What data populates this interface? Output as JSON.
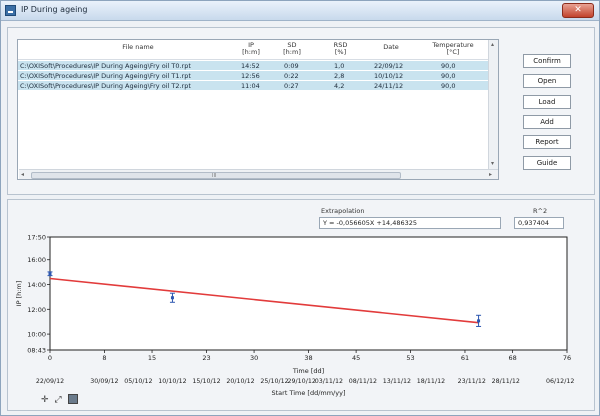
{
  "window": {
    "title": "IP During ageing",
    "close_glyph": "✕"
  },
  "table": {
    "columns": [
      {
        "key": "file",
        "label": "File name"
      },
      {
        "key": "ip",
        "label": "IP\n[h:m]"
      },
      {
        "key": "sd",
        "label": "SD\n[h:m]"
      },
      {
        "key": "rsd",
        "label": "RSD\n[%]"
      },
      {
        "key": "date",
        "label": "Date"
      },
      {
        "key": "temp",
        "label": "Temperature\n[°C]"
      }
    ],
    "rows": [
      {
        "file": "C:\\OXISoft\\Procedures\\IP During Ageing\\Fry oil T0.rpt",
        "ip": "14:52",
        "sd": "0:09",
        "rsd": "1,0",
        "date": "22/09/12",
        "temp": "90,0"
      },
      {
        "file": "C:\\OXISoft\\Procedures\\IP During Ageing\\Fry oil T1.rpt",
        "ip": "12:56",
        "sd": "0:22",
        "rsd": "2,8",
        "date": "10/10/12",
        "temp": "90,0"
      },
      {
        "file": "C:\\OXISoft\\Procedures\\IP During Ageing\\Fry oil T2.rpt",
        "ip": "11:04",
        "sd": "0:27",
        "rsd": "4,2",
        "date": "24/11/12",
        "temp": "90,0"
      }
    ],
    "scroll_left": "◂",
    "scroll_right": "▸",
    "scroll_up": "▴",
    "scroll_down": "▾",
    "scroll_grip": "III"
  },
  "buttons": {
    "confirm": "Confirm",
    "open": "Open",
    "load": "Load",
    "add": "Add",
    "report": "Report",
    "guide": "Guide"
  },
  "extrapolation": {
    "label": "Extrapolation",
    "equation": "Y = -0,056605X +14,486325",
    "r2_label": "R^2",
    "r2_value": "0,937404"
  },
  "colors": {
    "fit_line": "#e23b3b",
    "points": "#2b56b0",
    "row_highlight": "#c9e3ef"
  },
  "chart_data": {
    "type": "scatter",
    "ylabel": "IP [h:m]",
    "xlabel": "Time [dd]",
    "x2label": "Start Time [dd/mm/yy]",
    "xlim": [
      0,
      76
    ],
    "ylim": [
      8.717,
      17.833
    ],
    "x_ticks": [
      0,
      8,
      15,
      23,
      30,
      38,
      45,
      53,
      61,
      68,
      76
    ],
    "y_ticks": [
      {
        "value": 8.717,
        "label": "08:43"
      },
      {
        "value": 10,
        "label": "10:00"
      },
      {
        "value": 12,
        "label": "12:00"
      },
      {
        "value": 14,
        "label": "14:00"
      },
      {
        "value": 16,
        "label": "16:00"
      },
      {
        "value": 17.833,
        "label": "17:50"
      }
    ],
    "date_ticks": [
      {
        "x": 0,
        "label": "22/09/12"
      },
      {
        "x": 8,
        "label": "30/09/12"
      },
      {
        "x": 13,
        "label": "05/10/12"
      },
      {
        "x": 18,
        "label": "10/10/12"
      },
      {
        "x": 23,
        "label": "15/10/12"
      },
      {
        "x": 28,
        "label": "20/10/12"
      },
      {
        "x": 33,
        "label": "25/10/12"
      },
      {
        "x": 37,
        "label": "29/10/12"
      },
      {
        "x": 41,
        "label": "03/11/12"
      },
      {
        "x": 46,
        "label": "08/11/12"
      },
      {
        "x": 51,
        "label": "13/11/12"
      },
      {
        "x": 56,
        "label": "18/11/12"
      },
      {
        "x": 62,
        "label": "23/11/12"
      },
      {
        "x": 67,
        "label": "28/11/12"
      },
      {
        "x": 75,
        "label": "06/12/12"
      }
    ],
    "series": [
      {
        "points": [
          {
            "x": 0,
            "y": 14.867,
            "err": 0.15
          },
          {
            "x": 18,
            "y": 12.933,
            "err": 0.367
          },
          {
            "x": 63,
            "y": 11.067,
            "err": 0.45
          }
        ]
      }
    ],
    "fit": {
      "slope": -0.056605,
      "intercept": 14.486325
    },
    "grid": false
  },
  "toolbar": {
    "cursor_glyph": "✛",
    "zoom_glyph": "⤢"
  }
}
